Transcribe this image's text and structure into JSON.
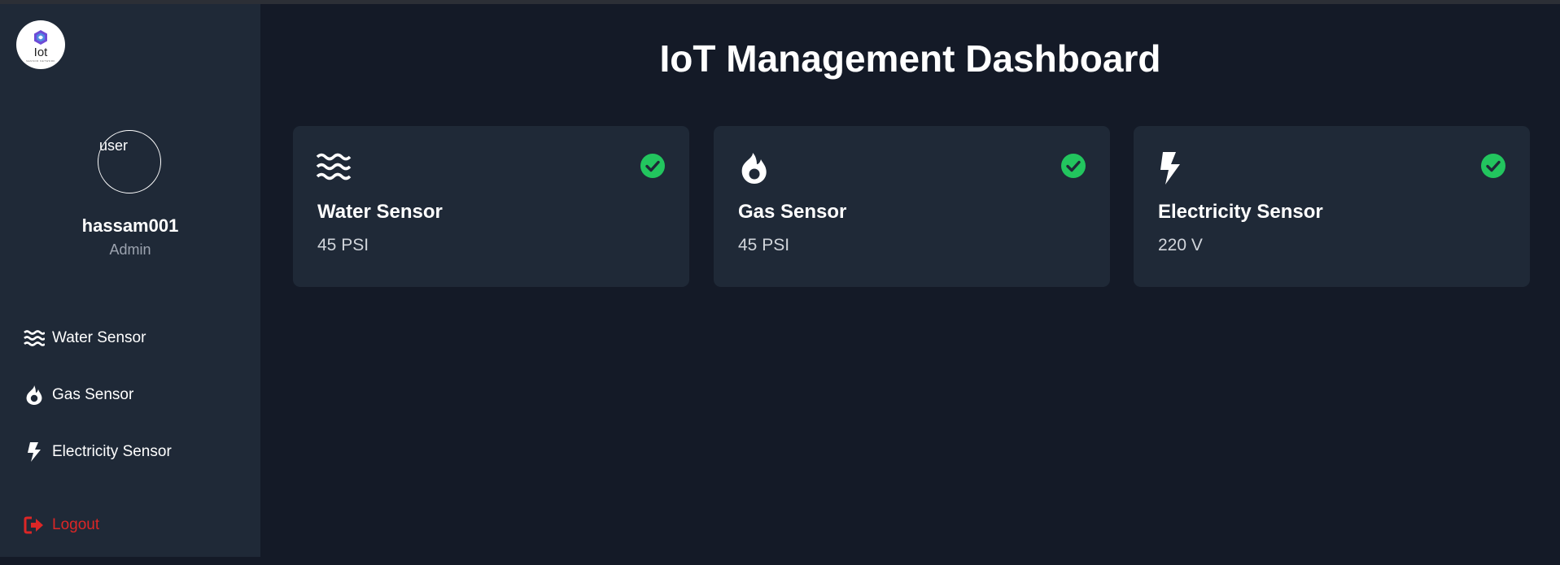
{
  "app": {
    "title": "IoT Management Dashboard",
    "logo": {
      "text": "Iot",
      "sub": "SENSOR NETWORK"
    }
  },
  "user": {
    "avatar_alt": "user",
    "name": "hassam001",
    "role": "Admin"
  },
  "sidebar": {
    "items": [
      {
        "label": "Water Sensor",
        "icon": "water-waves-icon"
      },
      {
        "label": "Gas Sensor",
        "icon": "fire-icon"
      },
      {
        "label": "Electricity Sensor",
        "icon": "bolt-icon"
      }
    ],
    "logout": {
      "label": "Logout",
      "icon": "logout-icon"
    }
  },
  "cards": [
    {
      "title": "Water Sensor",
      "value": "45 PSI",
      "icon": "water-waves-icon",
      "status": "check-circle-icon"
    },
    {
      "title": "Gas Sensor",
      "value": "45 PSI",
      "icon": "fire-icon",
      "status": "check-circle-icon"
    },
    {
      "title": "Electricity Sensor",
      "value": "220 V",
      "icon": "bolt-icon",
      "status": "check-circle-icon"
    }
  ],
  "colors": {
    "background": "#141a27",
    "panel": "#1f2937",
    "status_ok": "#22c55e",
    "logout": "#dc2626",
    "muted": "#9ca3af"
  }
}
